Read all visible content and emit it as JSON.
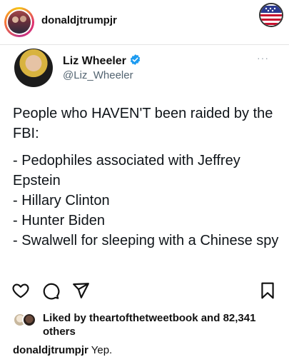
{
  "header": {
    "username": "donaldjtrumpjr"
  },
  "tweet": {
    "display_name": "Liz Wheeler",
    "handle": "@Liz_Wheeler",
    "more": "···",
    "text_intro": "People who HAVEN'T been raided by the FBI:",
    "lines": [
      "- Pedophiles associated with Jeffrey Epstein",
      "- Hillary Clinton",
      "- Hunter Biden",
      "- Swalwell for sleeping with a Chinese spy"
    ]
  },
  "likes": {
    "prefix": "Liked by",
    "user": "theartofthetweetbook",
    "middle": "and",
    "count": "82,341",
    "suffix": "others"
  },
  "caption": {
    "user": "donaldjtrumpjr",
    "text": "Yep."
  },
  "colors": {
    "verified": "#1d9bf0",
    "handle_gray": "#536471"
  }
}
